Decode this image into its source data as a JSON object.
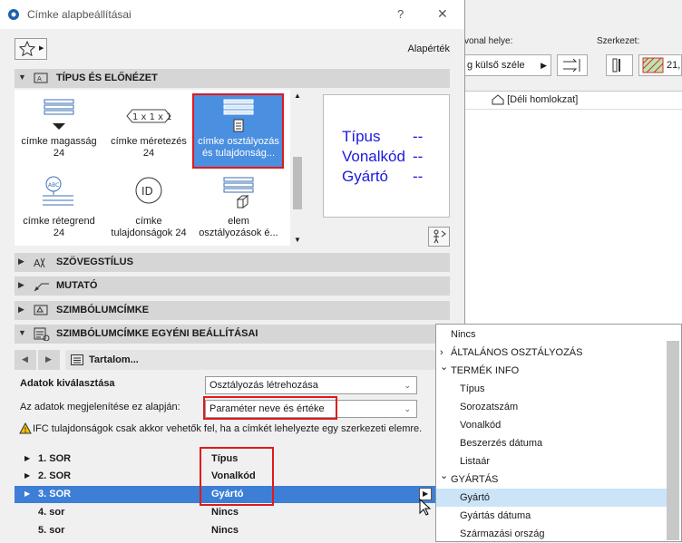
{
  "background_app": {
    "line_position_label": "vonal helye:",
    "structure_label": "Szerkezet:",
    "line_position_value": "g külső széle",
    "structure_value": "21,",
    "view_tab": "[Déli homlokzat]"
  },
  "dialog": {
    "title": "Címke alapbeállításai",
    "help": "?",
    "close": "✕",
    "default_label": "Alapérték"
  },
  "sections": {
    "type_preview": "TÍPUS ÉS ELŐNÉZET",
    "text_style": "SZÖVEGSTÍLUS",
    "pointer": "MUTATÓ",
    "symbol_label": "SZIMBÓLUMCÍMKE",
    "symbol_label_custom": "SZIMBÓLUMCÍMKE EGYÉNI BEÁLLÍTÁSAI"
  },
  "gallery": {
    "items": [
      {
        "label": "címke magasság\n24",
        "icon": "height-label-icon"
      },
      {
        "label": "címke méretezés\n24",
        "icon": "dimension-label-icon"
      },
      {
        "label": "címke osztályozás\nés tulajdonság...",
        "icon": "classification-label-icon",
        "selected": true
      },
      {
        "label": "címke rétegrend\n24",
        "icon": "layer-label-icon"
      },
      {
        "label": "címke\ntulajdonságok 24",
        "icon": "id-label-icon"
      },
      {
        "label": "elem\nosztályozások é...",
        "icon": "element-classification-icon"
      }
    ]
  },
  "preview": {
    "lines": [
      "Típus",
      "Vonalkód",
      "Gyártó"
    ],
    "dash": "--"
  },
  "content_nav": {
    "label": "Tartalom..."
  },
  "data_selection": {
    "label": "Adatok kiválasztása",
    "value": "Osztályozás létrehozása"
  },
  "display_basis": {
    "label": "Az adatok megjelenítése ez alapján:",
    "value": "Paraméter neve és értéke"
  },
  "warning": {
    "text": "IFC tulajdonságok csak akkor vehetők fel, ha a címkét lehelyezte egy szerkezeti elemre."
  },
  "rows": [
    {
      "label": "1. SOR",
      "value": "Típus"
    },
    {
      "label": "2. SOR",
      "value": "Vonalkód"
    },
    {
      "label": "3. SOR",
      "value": "Gyártó",
      "selected": true
    },
    {
      "label": "4. sor",
      "value": "Nincs"
    },
    {
      "label": "5. sor",
      "value": "Nincs"
    }
  ],
  "popup": {
    "items": [
      {
        "label": "Nincs",
        "indent": 0,
        "arrow": ""
      },
      {
        "label": "ÁLTALÁNOS OSZTÁLYOZÁS",
        "indent": 0,
        "arrow": "›"
      },
      {
        "label": "TERMÉK INFO",
        "indent": 0,
        "arrow": "⌄"
      },
      {
        "label": "Típus",
        "indent": 1,
        "arrow": ""
      },
      {
        "label": "Sorozatszám",
        "indent": 1,
        "arrow": ""
      },
      {
        "label": "Vonalkód",
        "indent": 1,
        "arrow": ""
      },
      {
        "label": "Beszerzés dátuma",
        "indent": 1,
        "arrow": ""
      },
      {
        "label": "Listaár",
        "indent": 1,
        "arrow": ""
      },
      {
        "label": "GYÁRTÁS",
        "indent": 0,
        "arrow": "⌄"
      },
      {
        "label": "Gyártó",
        "indent": 1,
        "arrow": "",
        "highlight": true
      },
      {
        "label": "Gyártás dátuma",
        "indent": 1,
        "arrow": ""
      },
      {
        "label": "Származási ország",
        "indent": 1,
        "arrow": ""
      }
    ]
  },
  "colors": {
    "selection": "#3d7fd6",
    "highlight": "#cce4f7",
    "annotation_red": "#e0191c",
    "preview_text": "#1a1adc"
  }
}
